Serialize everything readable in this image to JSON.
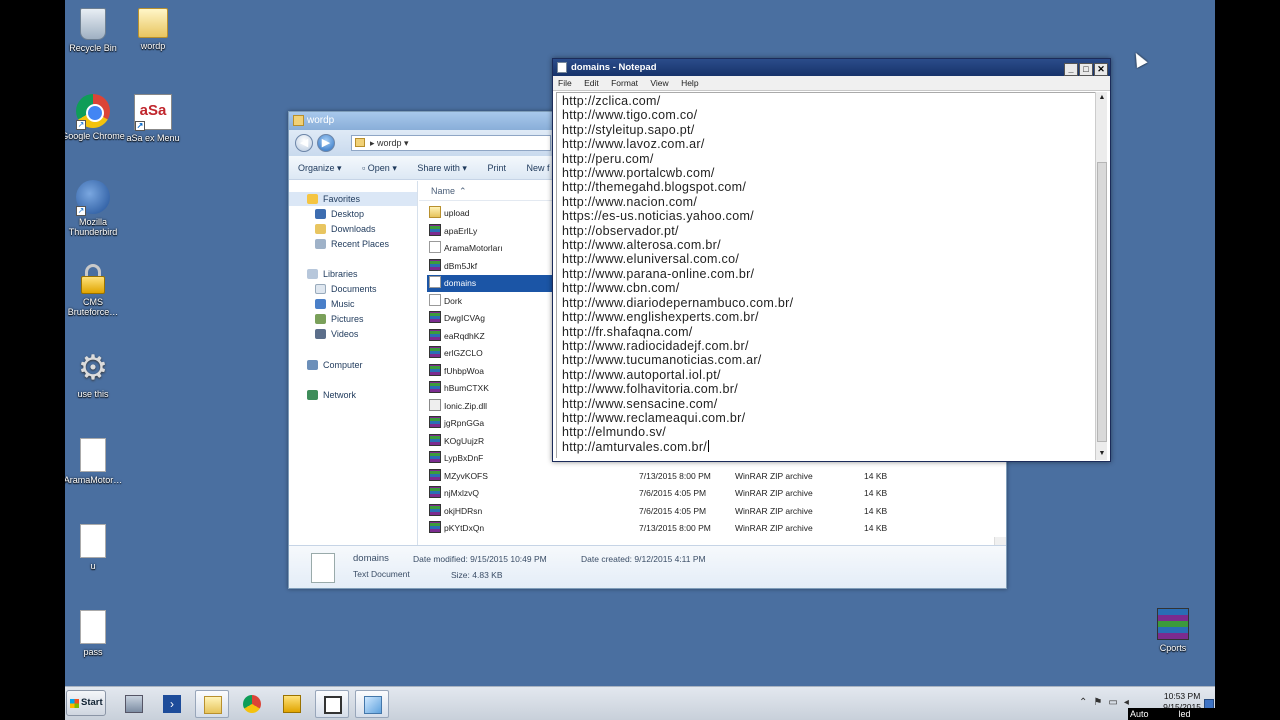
{
  "desktop": {
    "icons": [
      {
        "label": "Recycle Bin",
        "icon": "recycle-bin-icon"
      },
      {
        "label": "wordp",
        "icon": "folder-icon"
      },
      {
        "label": "Google Chrome",
        "icon": "chrome-icon"
      },
      {
        "label": "aSa ex Menu",
        "icon": "asa-icon",
        "glyph_text": "aSa"
      },
      {
        "label": "Mozilla Thunderbird",
        "icon": "thunderbird-icon"
      },
      {
        "label": "CMS Bruteforce…",
        "icon": "lock-icon"
      },
      {
        "label": "use this",
        "icon": "gear-icon"
      },
      {
        "label": "AramaMotor…",
        "icon": "document-icon"
      },
      {
        "label": "u",
        "icon": "document-icon"
      },
      {
        "label": "pass",
        "icon": "document-icon"
      },
      {
        "label": "Cports",
        "icon": "winrar-icon"
      }
    ]
  },
  "explorer": {
    "title": "wordp",
    "address": "wordp",
    "toolbar": {
      "organize": "Organize",
      "open": "Open",
      "share_with": "Share with",
      "print": "Print",
      "new": "New f"
    },
    "nav": {
      "favorites": "Favorites",
      "desktop": "Desktop",
      "downloads": "Downloads",
      "recent": "Recent Places",
      "libraries": "Libraries",
      "documents": "Documents",
      "music": "Music",
      "pictures": "Pictures",
      "videos": "Videos",
      "computer": "Computer",
      "network": "Network"
    },
    "column_name": "Name",
    "files": [
      {
        "name": "upload",
        "type": "folder",
        "date": "",
        "kind": "",
        "size": ""
      },
      {
        "name": "apaErlLy",
        "type": "rar",
        "date": "",
        "kind": "",
        "size": ""
      },
      {
        "name": "AramaMotorları",
        "type": "doc",
        "date": "",
        "kind": "",
        "size": ""
      },
      {
        "name": "dBm5Jkf",
        "type": "rar",
        "date": "",
        "kind": "",
        "size": ""
      },
      {
        "name": "domains",
        "type": "doc",
        "date": "",
        "kind": "",
        "size": "",
        "selected": true
      },
      {
        "name": "Dork",
        "type": "doc",
        "date": "",
        "kind": "",
        "size": ""
      },
      {
        "name": "DwgICVAg",
        "type": "rar",
        "date": "",
        "kind": "",
        "size": ""
      },
      {
        "name": "eaRqdhKZ",
        "type": "rar",
        "date": "",
        "kind": "",
        "size": ""
      },
      {
        "name": "erlGZCLO",
        "type": "rar",
        "date": "",
        "kind": "",
        "size": ""
      },
      {
        "name": "fUhbpWoa",
        "type": "rar",
        "date": "",
        "kind": "",
        "size": ""
      },
      {
        "name": "hBumCTXK",
        "type": "rar",
        "date": "",
        "kind": "",
        "size": ""
      },
      {
        "name": "Ionic.Zip.dll",
        "type": "dll",
        "date": "",
        "kind": "",
        "size": ""
      },
      {
        "name": "jgRpnGGa",
        "type": "rar",
        "date": "",
        "kind": "",
        "size": ""
      },
      {
        "name": "KOgUujzR",
        "type": "rar",
        "date": "",
        "kind": "",
        "size": ""
      },
      {
        "name": "LypBxDnF",
        "type": "rar",
        "date": "",
        "kind": "",
        "size": ""
      },
      {
        "name": "MZyvKOFS",
        "type": "rar",
        "date": "7/13/2015 8:00 PM",
        "kind": "WinRAR ZIP archive",
        "size": "14 KB"
      },
      {
        "name": "njMxlzvQ",
        "type": "rar",
        "date": "7/6/2015 4:05 PM",
        "kind": "WinRAR ZIP archive",
        "size": "14 KB"
      },
      {
        "name": "okjHDRsn",
        "type": "rar",
        "date": "7/6/2015 4:05 PM",
        "kind": "WinRAR ZIP archive",
        "size": "14 KB"
      },
      {
        "name": "pKYtDxQn",
        "type": "rar",
        "date": "7/13/2015 8:00 PM",
        "kind": "WinRAR ZIP archive",
        "size": "14 KB"
      }
    ],
    "details": {
      "name": "domains",
      "type": "Text Document",
      "modified": "Date modified: 9/15/2015 10:49 PM",
      "created": "Date created: 9/12/2015 4:11 PM",
      "size": "Size: 4.83 KB"
    }
  },
  "notepad": {
    "title": "domains - Notepad",
    "menu": {
      "file": "File",
      "edit": "Edit",
      "format": "Format",
      "view": "View",
      "help": "Help"
    },
    "lines": [
      "http://zclica.com/",
      "http://www.tigo.com.co/",
      "http://styleitup.sapo.pt/",
      "http://www.lavoz.com.ar/",
      "http://peru.com/",
      "http://www.portalcwb.com/",
      "http://themegahd.blogspot.com/",
      "http://www.nacion.com/",
      "https://es-us.noticias.yahoo.com/",
      "http://observador.pt/",
      "http://www.alterosa.com.br/",
      "http://www.eluniversal.com.co/",
      "http://www.parana-online.com.br/",
      "http://www.cbn.com/",
      "http://www.diariodepernambuco.com.br/",
      "http://www.englishexperts.com.br/",
      "http://fr.shafaqna.com/",
      "http://www.radiocidadejf.com.br/",
      "http://www.tucumanoticias.com.ar/",
      "http://www.autoportal.iol.pt/",
      "http://www.folhavitoria.com.br/",
      "http://www.sensacine.com/",
      "http://www.reclameaqui.com.br/",
      "http://elmundo.sv/",
      "http://amturvales.com.br/"
    ]
  },
  "taskbar": {
    "start": "Start",
    "clock_time": "10:53 PM",
    "clock_date": "9/15/2015",
    "notification": "Auto            led"
  }
}
